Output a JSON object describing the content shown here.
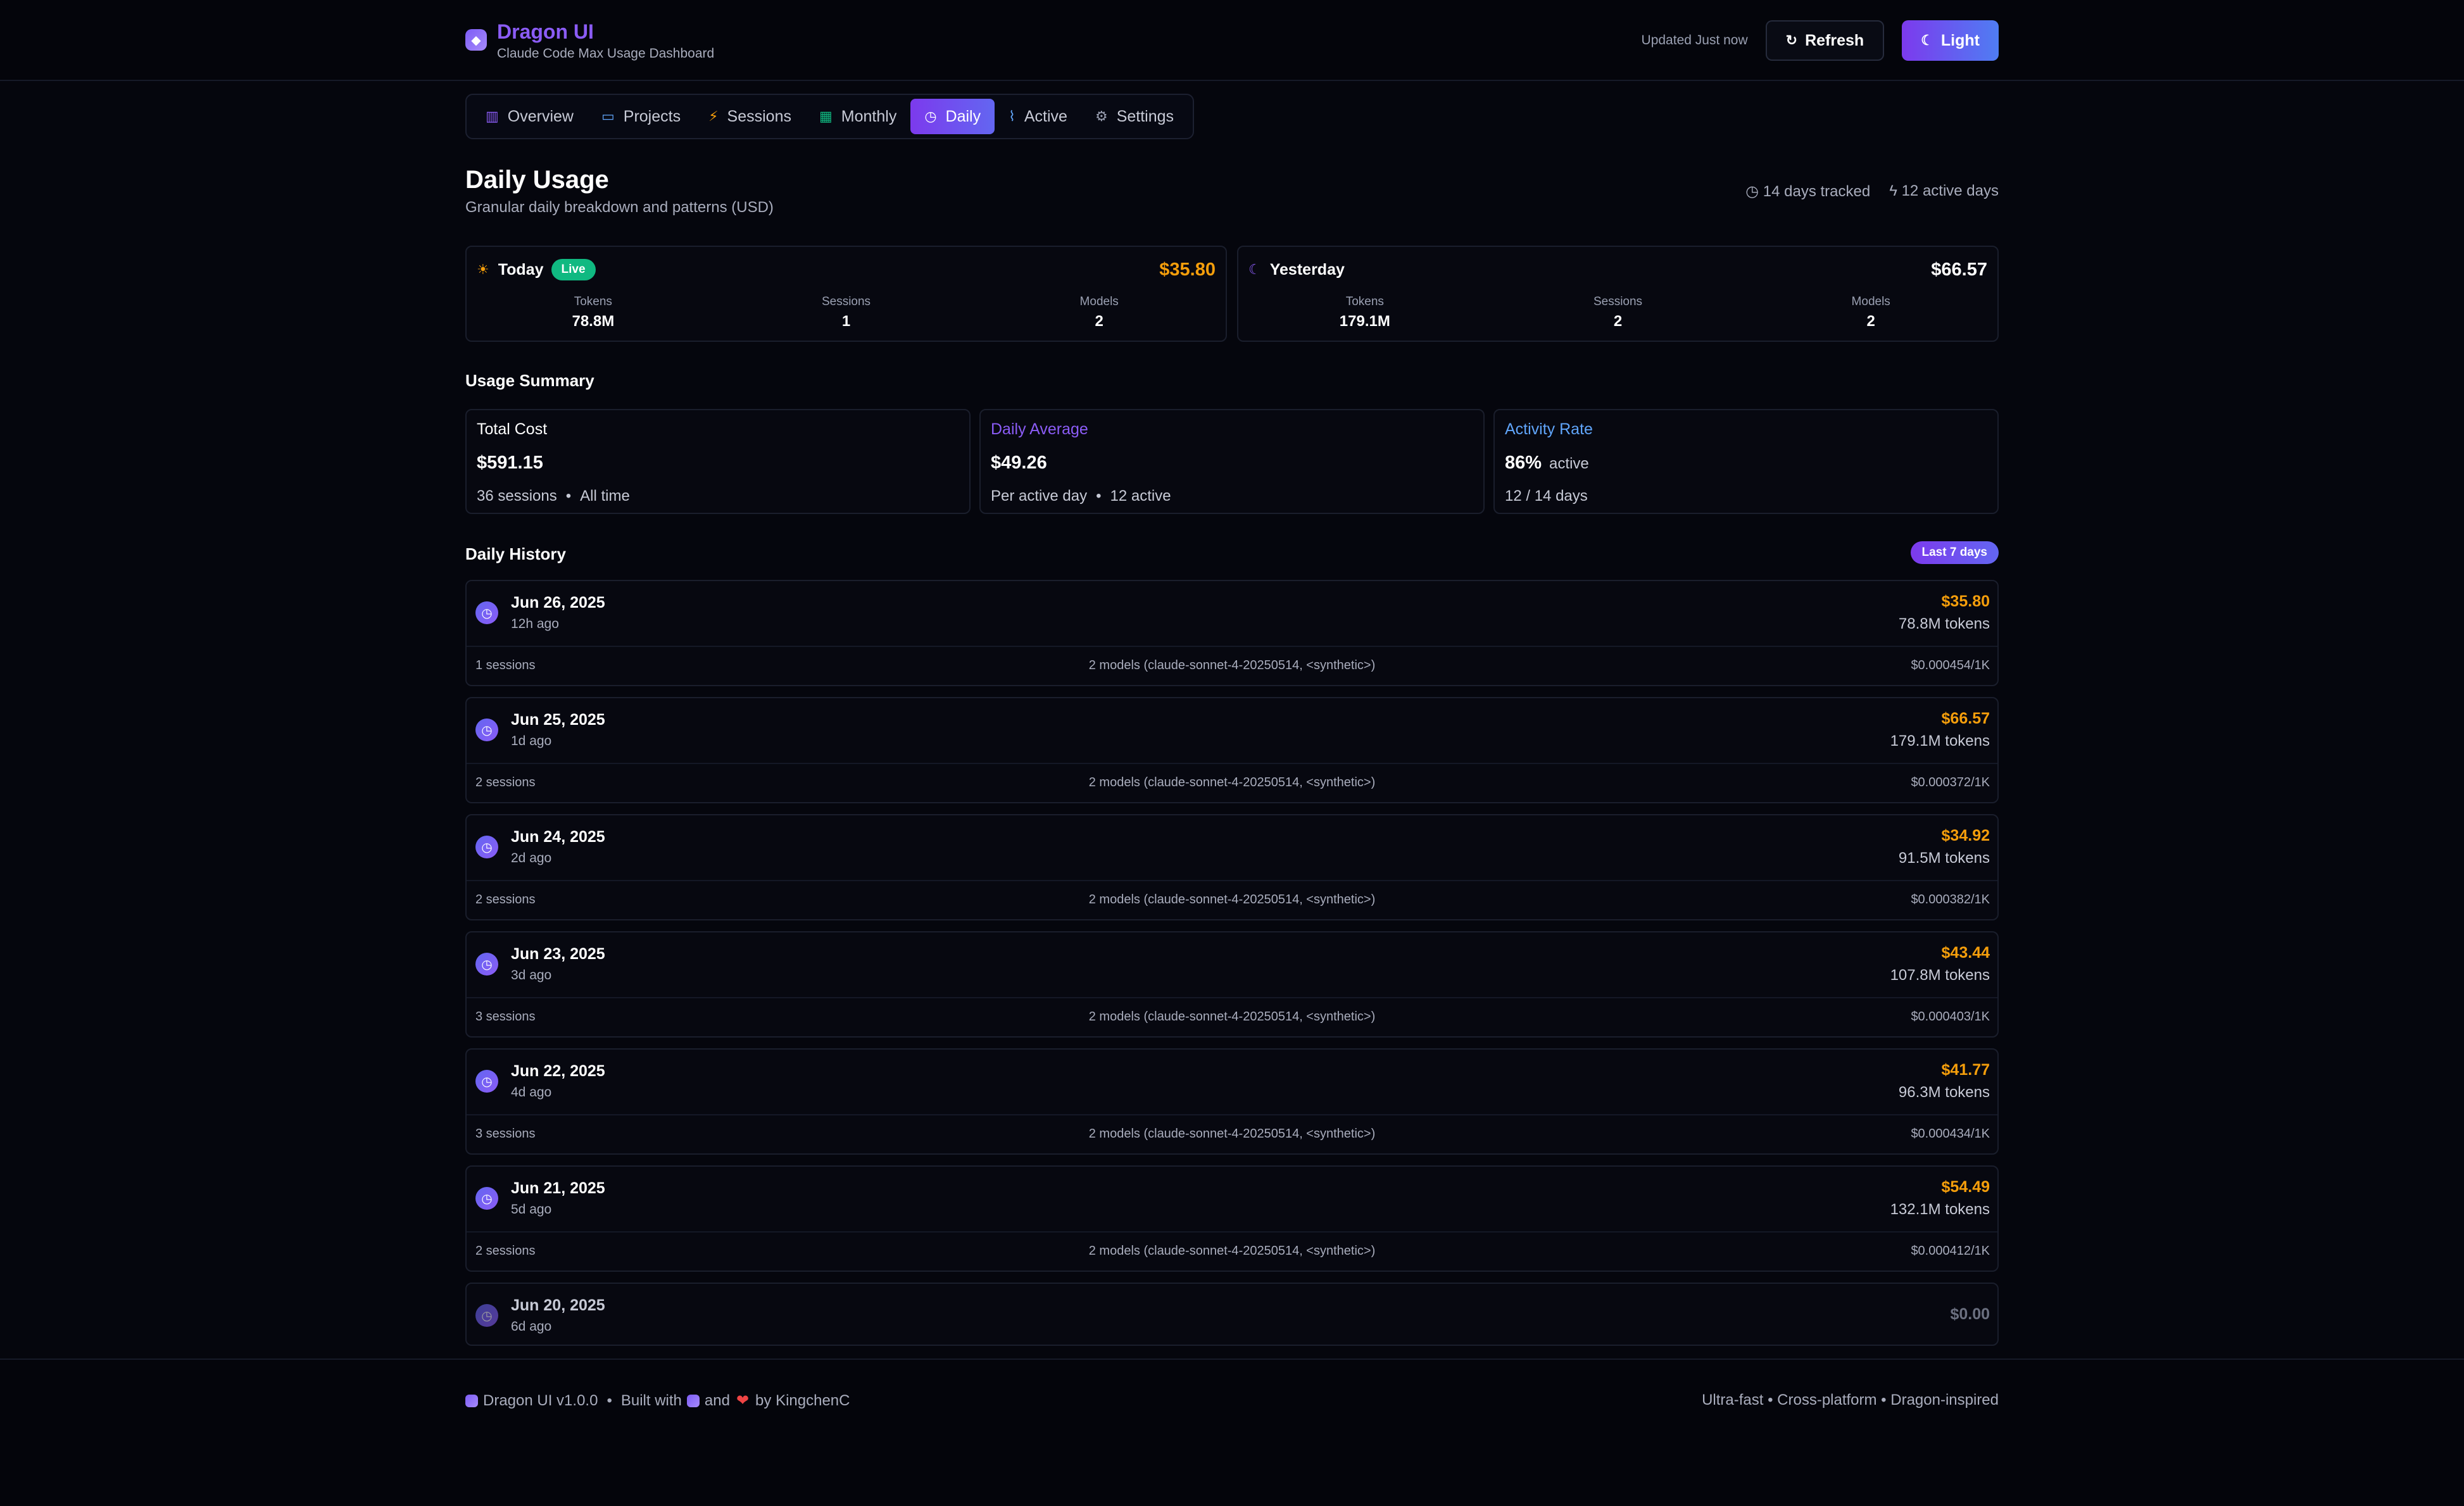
{
  "header": {
    "title": "Dragon UI",
    "subtitle": "Claude Code Max Usage Dashboard",
    "updated": "Updated Just now",
    "refresh_label": "Refresh",
    "theme_label": "Light"
  },
  "tabs": [
    {
      "label": "Overview",
      "icon": "chart-icon",
      "icon_char": "▥",
      "color": "#8b5cf6"
    },
    {
      "label": "Projects",
      "icon": "folder-icon",
      "icon_char": "▭",
      "color": "#60a5fa"
    },
    {
      "label": "Sessions",
      "icon": "bolt-icon",
      "icon_char": "⚡",
      "color": "#f59e0b"
    },
    {
      "label": "Monthly",
      "icon": "calendar-icon",
      "icon_char": "▦",
      "color": "#10b981"
    },
    {
      "label": "Daily",
      "icon": "clock-icon",
      "icon_char": "◷",
      "color": "#ffffff",
      "active": true
    },
    {
      "label": "Active",
      "icon": "activity-icon",
      "icon_char": "⌇",
      "color": "#60a5fa"
    },
    {
      "label": "Settings",
      "icon": "gear-icon",
      "icon_char": "⚙",
      "color": "#9aa0b2"
    }
  ],
  "page": {
    "title": "Daily Usage",
    "subtitle": "Granular daily breakdown and patterns (USD)",
    "tracked": "14 days tracked",
    "active_days": "12 active days"
  },
  "today": {
    "label": "Today",
    "badge": "Live",
    "cost": "$35.80",
    "tokens_label": "Tokens",
    "tokens": "78.8M",
    "sessions_label": "Sessions",
    "sessions": "1",
    "models_label": "Models",
    "models": "2"
  },
  "yesterday": {
    "label": "Yesterday",
    "cost": "$66.57",
    "tokens_label": "Tokens",
    "tokens": "179.1M",
    "sessions_label": "Sessions",
    "sessions": "2",
    "models_label": "Models",
    "models": "2"
  },
  "summary": {
    "title": "Usage Summary",
    "total": {
      "label": "Total Cost",
      "value": "$591.15",
      "sessions": "36 sessions",
      "scope": "All time"
    },
    "average": {
      "label": "Daily Average",
      "value": "$49.26",
      "desc": "Per active day",
      "active": "12 active"
    },
    "activity": {
      "label": "Activity Rate",
      "value": "86%",
      "suffix": "active",
      "desc": "12 / 14 days"
    }
  },
  "history": {
    "title": "Daily History",
    "badge": "Last 7 days",
    "rows": [
      {
        "date": "Jun 26, 2025",
        "ago": "12h ago",
        "cost": "$35.80",
        "tokens": "78.8M tokens",
        "sessions": "1 sessions",
        "models": "2 models (claude-sonnet-4-20250514, <synthetic>)",
        "rate": "$0.000454/1K"
      },
      {
        "date": "Jun 25, 2025",
        "ago": "1d ago",
        "cost": "$66.57",
        "tokens": "179.1M tokens",
        "sessions": "2 sessions",
        "models": "2 models (claude-sonnet-4-20250514, <synthetic>)",
        "rate": "$0.000372/1K"
      },
      {
        "date": "Jun 24, 2025",
        "ago": "2d ago",
        "cost": "$34.92",
        "tokens": "91.5M tokens",
        "sessions": "2 sessions",
        "models": "2 models (claude-sonnet-4-20250514, <synthetic>)",
        "rate": "$0.000382/1K"
      },
      {
        "date": "Jun 23, 2025",
        "ago": "3d ago",
        "cost": "$43.44",
        "tokens": "107.8M tokens",
        "sessions": "3 sessions",
        "models": "2 models (claude-sonnet-4-20250514, <synthetic>)",
        "rate": "$0.000403/1K"
      },
      {
        "date": "Jun 22, 2025",
        "ago": "4d ago",
        "cost": "$41.77",
        "tokens": "96.3M tokens",
        "sessions": "3 sessions",
        "models": "2 models (claude-sonnet-4-20250514, <synthetic>)",
        "rate": "$0.000434/1K"
      },
      {
        "date": "Jun 21, 2025",
        "ago": "5d ago",
        "cost": "$54.49",
        "tokens": "132.1M tokens",
        "sessions": "2 sessions",
        "models": "2 models (claude-sonnet-4-20250514, <synthetic>)",
        "rate": "$0.000412/1K"
      },
      {
        "date": "Jun 20, 2025",
        "ago": "6d ago",
        "cost": "$0.00"
      }
    ]
  },
  "footer": {
    "version": "Dragon UI v1.0.0",
    "built_with": "Built with",
    "and": "and",
    "by": "by KingchenC",
    "tagline": "Ultra-fast • Cross-platform • Dragon-inspired"
  },
  "colors": {
    "accent": "#8b5cf6",
    "cost": "#f59e0b",
    "live": "#10b981",
    "activity": "#60a5fa"
  }
}
